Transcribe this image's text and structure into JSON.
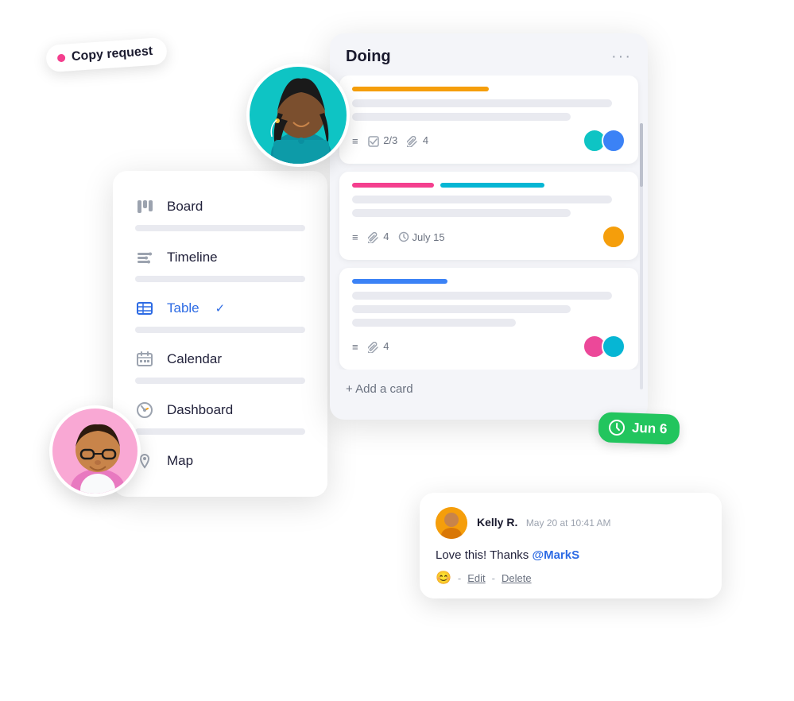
{
  "copy_request": {
    "label": "Copy request"
  },
  "sidebar": {
    "items": [
      {
        "id": "board",
        "label": "Board",
        "icon": "board-icon"
      },
      {
        "id": "timeline",
        "label": "Timeline",
        "icon": "timeline-icon"
      },
      {
        "id": "table",
        "label": "Table",
        "icon": "table-icon",
        "active": true,
        "check": "✓"
      },
      {
        "id": "calendar",
        "label": "Calendar",
        "icon": "calendar-icon"
      },
      {
        "id": "dashboard",
        "label": "Dashboard",
        "icon": "dashboard-icon"
      },
      {
        "id": "map",
        "label": "Map",
        "icon": "map-icon"
      }
    ]
  },
  "kanban": {
    "column_title": "Doing",
    "dots": "···",
    "cards": [
      {
        "color": "#f59e0b",
        "lines": [
          "long",
          "medium"
        ],
        "meta": {
          "list": "≡",
          "tasks": "2/3",
          "attachments": "4"
        },
        "avatars": [
          "teal",
          "blue"
        ]
      },
      {
        "color_bars": [
          "#f43f8e",
          "#06b6d4"
        ],
        "lines": [
          "long",
          "medium"
        ],
        "meta": {
          "list": "≡",
          "attachments": "4",
          "date": "July 15"
        },
        "avatars": [
          "amber"
        ]
      },
      {
        "color": "#3b82f6",
        "lines": [
          "long",
          "medium",
          "short"
        ],
        "meta": {
          "list": "≡",
          "attachments": "4"
        },
        "avatars": [
          "pink",
          "cyan"
        ]
      }
    ],
    "add_card": "+ Add a card"
  },
  "date_badge": {
    "icon": "clock-icon",
    "label": "Jun 6"
  },
  "comment": {
    "user": "Kelly R.",
    "time": "May 20 at 10:41 AM",
    "text": "Love this! Thanks ",
    "mention": "@MarkS",
    "emoji_icon": "😊",
    "actions": {
      "separator": " - ",
      "edit": "Edit",
      "delete": "Delete"
    }
  }
}
